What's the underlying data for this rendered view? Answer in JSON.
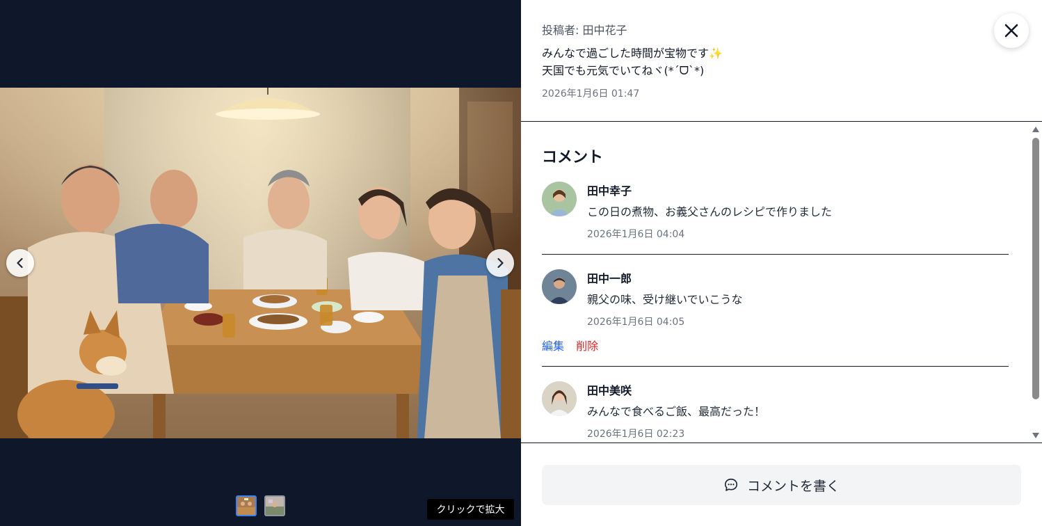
{
  "post": {
    "author": "投稿者: 田中花子",
    "caption_line1": "みんなで過ごした時間が宝物です✨",
    "caption_line2": "天国でも元気でいてねヾ(*´ᗜ`*)",
    "date": "2026年1月6日 01:47"
  },
  "media": {
    "zoom_hint": "クリックで拡大",
    "thumbnails": [
      {
        "active": true
      },
      {
        "active": false
      }
    ]
  },
  "comments": {
    "title": "コメント",
    "items": [
      {
        "name": "田中幸子",
        "text": "この日の煮物、お義父さんのレシピで作りました",
        "date": "2026年1月6日 04:04"
      },
      {
        "name": "田中一郎",
        "text": "親父の味、受け継いでいこうな",
        "date": "2026年1月6日 04:05",
        "edit_label": "編集",
        "delete_label": "削除"
      },
      {
        "name": "田中美咲",
        "text": "みんなで食べるご飯、最高だった！",
        "date": "2026年1月6日 02:23"
      }
    ]
  },
  "footer": {
    "write_label": "コメントを書く"
  },
  "colors": {
    "media_bg": "#0f172a",
    "accent": "#2563eb",
    "danger": "#dc2626"
  },
  "icons": {
    "close": "close-icon",
    "prev": "chevron-left-icon",
    "next": "chevron-right-icon",
    "comment": "chat-bubble-icon"
  }
}
